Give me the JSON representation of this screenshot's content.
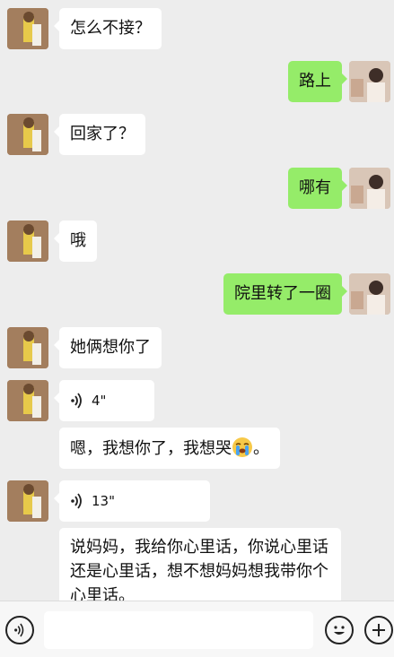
{
  "messages": [
    {
      "side": "in",
      "type": "text",
      "text": "怎么不接？"
    },
    {
      "side": "out",
      "type": "text",
      "text": "路上"
    },
    {
      "side": "in",
      "type": "text",
      "text": "回家了？"
    },
    {
      "side": "out",
      "type": "text",
      "text": "哪有"
    },
    {
      "side": "in",
      "type": "text",
      "text": "哦"
    },
    {
      "side": "out",
      "type": "text",
      "text": "院里转了一圈"
    },
    {
      "side": "in",
      "type": "text",
      "text": "她俩想你了"
    },
    {
      "side": "in",
      "type": "voice",
      "duration": "4\""
    },
    {
      "side": "in",
      "type": "text",
      "text_before": "嗯，我想你了，我想哭",
      "emoji": "loudly-crying-face",
      "text_after": "。"
    },
    {
      "side": "in",
      "type": "voice",
      "duration": "13\""
    },
    {
      "side": "in",
      "type": "text",
      "text": "说妈妈，我给你心里话，你说心里话还是心里话，想不想妈妈想我带你个心里话。"
    }
  ],
  "inputbar": {
    "voice_icon": "voice-toggle-icon",
    "emoji_icon": "emoji-icon",
    "plus_icon": "plus-icon",
    "input_value": ""
  },
  "colors": {
    "background": "#ededed",
    "incoming_bubble": "#ffffff",
    "outgoing_bubble": "#95ec69"
  }
}
